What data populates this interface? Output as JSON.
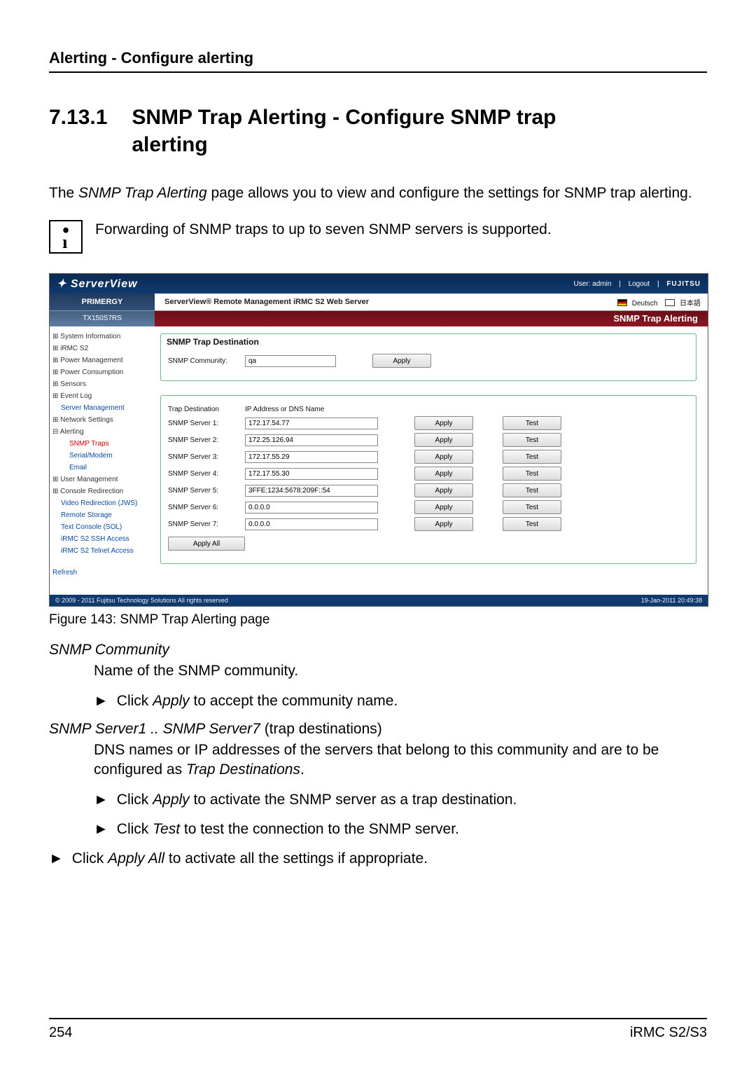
{
  "runningHead": "Alerting - Configure alerting",
  "section": {
    "num": "7.13.1",
    "title": "SNMP Trap Alerting - Configure SNMP trap alerting"
  },
  "intro": {
    "pre": "The ",
    "em": "SNMP Trap Alerting",
    "post": " page allows you to view and configure the settings for SNMP trap alerting."
  },
  "infoNote": "Forwarding of SNMP traps to up to seven SNMP servers is supported.",
  "figureCaption": "Figure 143: SNMP Trap Alerting page",
  "screenshot": {
    "brand": "ServerView",
    "user": "User: admin",
    "logoutLabel": "Logout",
    "vendor": "FUJITSU",
    "primergy": "PRIMERGY",
    "webServer": "ServerView® Remote Management iRMC S2 Web Server",
    "lang": {
      "de": "Deutsch",
      "jp": "日本語"
    },
    "model": "TX150S7RS",
    "pageTitle": "SNMP Trap Alerting",
    "nav": [
      {
        "t": "System Information",
        "cls": "exp",
        "pre": "⊞ "
      },
      {
        "t": "iRMC S2",
        "cls": "exp",
        "pre": "⊞ "
      },
      {
        "t": "Power Management",
        "cls": "exp",
        "pre": "⊞ "
      },
      {
        "t": "Power Consumption",
        "cls": "exp",
        "pre": "⊞ "
      },
      {
        "t": "Sensors",
        "cls": "exp",
        "pre": "⊞ "
      },
      {
        "t": "Event Log",
        "cls": "exp",
        "pre": "⊞ "
      },
      {
        "t": "Server Management",
        "cls": "lnk ind1",
        "pre": ""
      },
      {
        "t": "Network Settings",
        "cls": "exp",
        "pre": "⊞ "
      },
      {
        "t": "Alerting",
        "cls": "exp",
        "pre": "⊟ "
      },
      {
        "t": "SNMP Traps",
        "cls": "sel ind2",
        "pre": ""
      },
      {
        "t": "Serial/Modem",
        "cls": "lnk ind2",
        "pre": ""
      },
      {
        "t": "Email",
        "cls": "lnk ind2",
        "pre": ""
      },
      {
        "t": "User Management",
        "cls": "exp",
        "pre": "⊞ "
      },
      {
        "t": "Console Redirection",
        "cls": "exp",
        "pre": "⊞ "
      },
      {
        "t": "Video Redirection (JWS)",
        "cls": "lnk ind1",
        "pre": ""
      },
      {
        "t": "Remote Storage",
        "cls": "lnk ind1",
        "pre": ""
      },
      {
        "t": "Text Console (SOL)",
        "cls": "lnk ind1",
        "pre": ""
      },
      {
        "t": "iRMC S2 SSH Access",
        "cls": "lnk ind1",
        "pre": ""
      },
      {
        "t": "iRMC S2 Telnet Access",
        "cls": "lnk ind1",
        "pre": ""
      }
    ],
    "refresh": "Refresh",
    "panel1": {
      "title": "SNMP Trap Destination",
      "communityLabel": "SNMP Community:",
      "communityValue": "qa",
      "applyLabel": "Apply"
    },
    "panel2": {
      "hdrDest": "Trap Destination",
      "hdrAddr": "IP Address or DNS Name",
      "applyLabel": "Apply",
      "testLabel": "Test",
      "applyAllLabel": "Apply All",
      "servers": [
        {
          "label": "SNMP Server 1:",
          "value": "172.17.54.77"
        },
        {
          "label": "SNMP Server 2:",
          "value": "172.25.126.94"
        },
        {
          "label": "SNMP Server 3:",
          "value": "172.17.55.29"
        },
        {
          "label": "SNMP Server 4:",
          "value": "172.17.55.30"
        },
        {
          "label": "SNMP Server 5:",
          "value": "3FFE:1234:5678:209F::54"
        },
        {
          "label": "SNMP Server 6:",
          "value": "0.0.0.0"
        },
        {
          "label": "SNMP Server 7:",
          "value": "0.0.0.0"
        }
      ]
    },
    "footer": {
      "left": "© 2009 - 2011 Fujitsu Technology Solutions All rights reserved",
      "right": "19-Jan-2011 20:49:38"
    }
  },
  "defs": {
    "community": {
      "term": "SNMP Community",
      "desc": "Name of the SNMP community.",
      "bullet": "Click ",
      "bEm": "Apply",
      "bPost": " to accept the community name."
    },
    "servers": {
      "termPre": "SNMP Server1 .. SNMP Server7",
      "termPost": " (trap destinations)",
      "desc1": "DNS names or IP addresses of the servers that belong to this community and are to be configured as ",
      "desc1Em": "Trap Destinations",
      "desc1Post": ".",
      "b1a": "Click ",
      "b1Em": "Apply",
      "b1b": " to activate the SNMP server as a trap destination.",
      "b2a": "Click ",
      "b2Em": "Test",
      "b2b": " to test the connection to the SNMP server."
    },
    "applyAll": {
      "a": "Click ",
      "em": "Apply All",
      "b": " to activate all the settings if appropriate."
    }
  },
  "pageFooter": {
    "left": "254",
    "right": "iRMC S2/S3"
  }
}
